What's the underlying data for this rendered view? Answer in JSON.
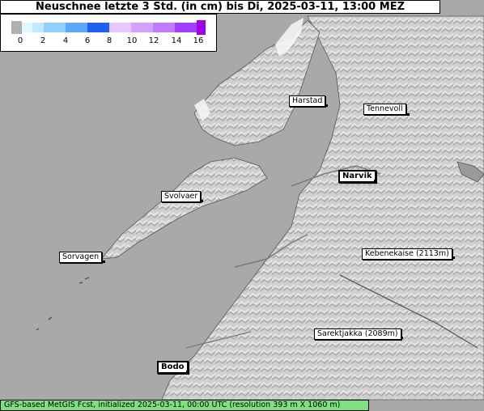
{
  "title": "Neuschnee letzte 3 Std. (in cm) bis Di, 2025-03-11, 13:00 MEZ",
  "legend": {
    "colors": [
      "#b0b0b0",
      "#dff8ff",
      "#c0eaff",
      "#90d0ff",
      "#5ca8ff",
      "#2060f0",
      "#e8c6ff",
      "#d6a0ff",
      "#c07aff",
      "#a040ff",
      "#a000e8"
    ],
    "ticks": [
      "0",
      "2",
      "4",
      "6",
      "8",
      "10",
      "12",
      "14",
      "16"
    ]
  },
  "places": [
    {
      "name": "Harstad",
      "bold": false
    },
    {
      "name": "Tennevoll",
      "bold": false
    },
    {
      "name": "Narvik",
      "bold": true
    },
    {
      "name": "Svolvaer",
      "bold": false
    },
    {
      "name": "Sorvagen",
      "bold": false
    },
    {
      "name": "Kebenekaise (2113m)",
      "bold": false
    },
    {
      "name": "Sarektjakka (2089m)",
      "bold": false
    },
    {
      "name": "Bodo",
      "bold": true
    }
  ],
  "footer": "GFS-based MetGIS Fcst, initialized 2025-03-11, 00:00 UTC  (resolution 393 m X 1060 m)",
  "colors": {
    "sea": "#a9a9a9",
    "land": "#c8c8c8",
    "footer_bg": "#7fe07f"
  }
}
